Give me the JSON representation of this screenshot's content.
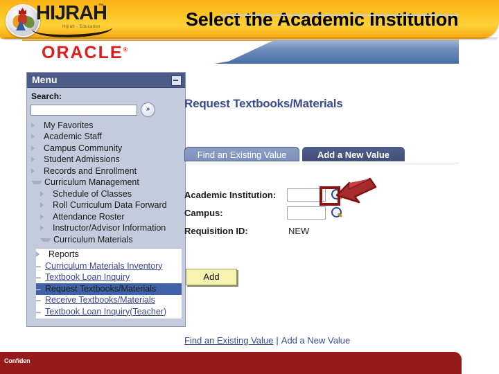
{
  "slide": {
    "title": "Select the Academic Institution",
    "footer_text": "Confiden"
  },
  "brand": {
    "logo_word": "HIJRAH",
    "logo_tm": "™",
    "logo_tagline": "Hijrah - Education",
    "oracle_logo": "ORACLE",
    "oracle_reg": "®"
  },
  "menu": {
    "header": "Menu",
    "minimize_icon": "minimize-icon",
    "search_label": "Search:",
    "search_value": "",
    "search_placeholder": "",
    "search_go_icon": "»",
    "items": [
      {
        "label": "My Favorites",
        "level": 1,
        "state": "collapsed"
      },
      {
        "label": "Academic Staff",
        "level": 1,
        "state": "collapsed"
      },
      {
        "label": "Campus Community",
        "level": 1,
        "state": "collapsed"
      },
      {
        "label": "Student Admissions",
        "level": 1,
        "state": "collapsed"
      },
      {
        "label": "Records and Enrollment",
        "level": 1,
        "state": "collapsed"
      },
      {
        "label": "Curriculum Management",
        "level": 1,
        "state": "expanded"
      },
      {
        "label": "Schedule of Classes",
        "level": 2,
        "state": "collapsed"
      },
      {
        "label": "Roll Curriculum Data Forward",
        "level": 2,
        "state": "collapsed"
      },
      {
        "label": "Attendance Roster",
        "level": 2,
        "state": "collapsed"
      },
      {
        "label": "Instructor/Advisor Information",
        "level": 2,
        "state": "collapsed"
      },
      {
        "label": "Curriculum Materials",
        "level": 2,
        "state": "expanded"
      }
    ],
    "sub_items": [
      {
        "label": "Reports",
        "type": "folder",
        "selected": false
      },
      {
        "label": "Curriculum Materials Inventory",
        "type": "link",
        "selected": false
      },
      {
        "label": "Textbook Loan Inquiry",
        "type": "link",
        "selected": false
      },
      {
        "label": "Request Textbooks/Materials",
        "type": "link",
        "selected": true
      },
      {
        "label": "Receive Textbooks/Materials",
        "type": "link",
        "selected": false
      },
      {
        "label": "Textbook Loan Inquiry(Teacher)",
        "type": "link",
        "selected": false
      }
    ]
  },
  "main": {
    "page_title": "Request Textbooks/Materials",
    "tabs": [
      {
        "label": "Find an Existing Value",
        "active": false
      },
      {
        "label": "Add a New Value",
        "active": true
      }
    ],
    "fields": [
      {
        "label": "Academic Institution:",
        "value": "",
        "type": "lookup",
        "icon": "magnifier-icon"
      },
      {
        "label": "Campus:",
        "value": "",
        "type": "lookup",
        "icon": "magnifier-icon"
      },
      {
        "label": "Requisition ID:",
        "value": "NEW",
        "type": "text"
      }
    ],
    "add_button": "Add",
    "bottom_links": {
      "find": "Find an Existing Value",
      "separator": "|",
      "add": "Add a New Value"
    }
  },
  "annotation": {
    "highlight_target": "academic-institution-lookup",
    "arrow_color": "#8f1111",
    "box_color": "#8f1111"
  },
  "colors": {
    "banner_gold": "#fcc322",
    "menu_header": "#4d5b88",
    "menu_body": "#c3cbdc",
    "selected_item": "#3f62a8",
    "oracle_red": "#e01b1b",
    "footer_red": "#951a1a",
    "link_blue": "#3b4a8e",
    "add_button": "#f6f3b2"
  }
}
